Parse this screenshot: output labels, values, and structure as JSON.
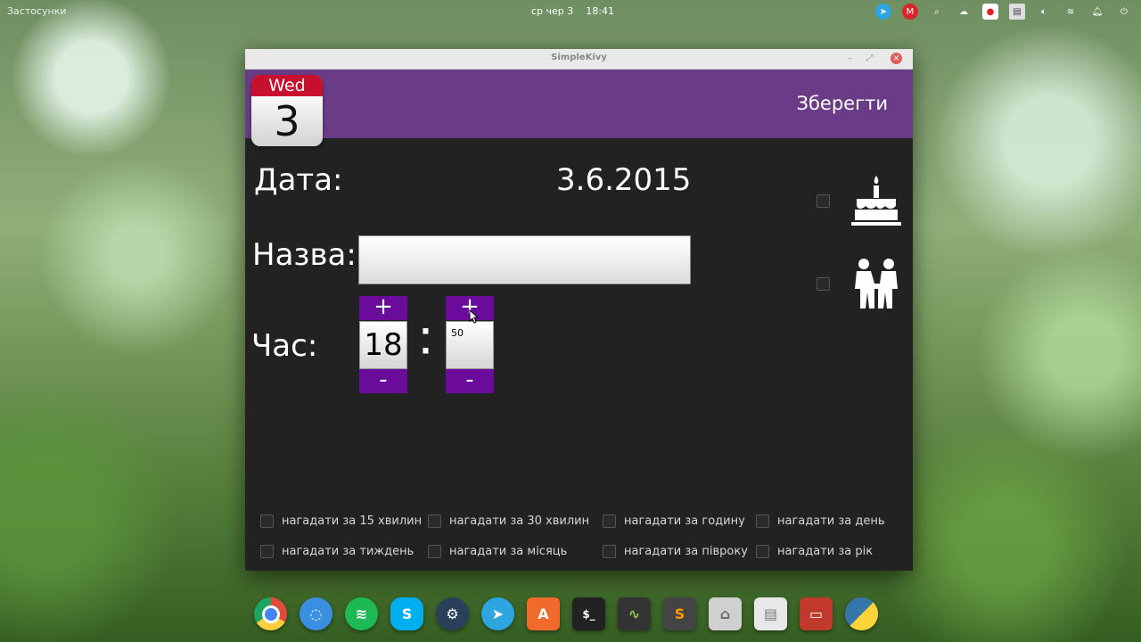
{
  "top_panel": {
    "apps_label": "Застосунки",
    "date": "ср чер 3",
    "time": "18:41",
    "tray_icons": [
      "telegram-icon",
      "mail-m-icon",
      "search-icon",
      "cloud-icon",
      "record-icon",
      "keyboard-icon",
      "volume-icon",
      "wifi-icon",
      "notification-icon",
      "power-icon"
    ]
  },
  "window": {
    "title": "SimpleKivy",
    "header": {
      "calendar_day": "Wed",
      "calendar_number": "3",
      "save_label": "Зберегти",
      "accent_color": "#6a3b87"
    },
    "date_label": "Дата:",
    "date_value": "3.6.2015",
    "name_label": "Назва:",
    "name_value": "",
    "time_label": "Час:",
    "hour": {
      "value": "18",
      "plus": "+",
      "minus": "-"
    },
    "minute": {
      "value": "50",
      "plus": "+",
      "minus": "-"
    },
    "time_separator": ":",
    "event_types": [
      {
        "icon": "birthday-cake-icon",
        "checked": false
      },
      {
        "icon": "meeting-people-icon",
        "checked": false
      }
    ],
    "reminders": [
      {
        "label": "нагадати за 15 хвилин",
        "checked": false
      },
      {
        "label": "нагадати за 30 хвилин",
        "checked": false
      },
      {
        "label": "нагадати за годину",
        "checked": false
      },
      {
        "label": "нагадати за день",
        "checked": false
      },
      {
        "label": "нагадати за тиждень",
        "checked": false
      },
      {
        "label": "нагадати за місяць",
        "checked": false
      },
      {
        "label": "нагадати за півроку",
        "checked": false
      },
      {
        "label": "нагадати за рік",
        "checked": false
      }
    ],
    "spin_color": "#6a0b9c"
  },
  "dock": {
    "items": [
      {
        "name": "chrome-icon",
        "glyph": "",
        "color": "#dd4b39"
      },
      {
        "name": "browser-icon",
        "glyph": "",
        "color": "#3b8fe0"
      },
      {
        "name": "spotify-icon",
        "glyph": "",
        "color": "#1db954"
      },
      {
        "name": "skype-icon",
        "glyph": "S",
        "color": "#00aff0"
      },
      {
        "name": "steam-icon",
        "glyph": "",
        "color": "#2a3f5a"
      },
      {
        "name": "telegram-icon",
        "glyph": "",
        "color": "#2ca5e0"
      },
      {
        "name": "appcenter-icon",
        "glyph": "A",
        "color": "#f06a2b"
      },
      {
        "name": "terminal-icon",
        "glyph": "$_",
        "color": "#222222"
      },
      {
        "name": "system-monitor-icon",
        "glyph": "",
        "color": "#333333"
      },
      {
        "name": "sublime-icon",
        "glyph": "S",
        "color": "#444444"
      },
      {
        "name": "files-icon",
        "glyph": "",
        "color": "#d0d0d0"
      },
      {
        "name": "keyboard-app-icon",
        "glyph": "",
        "color": "#e8e8e8"
      },
      {
        "name": "screen-recorder-icon",
        "glyph": "",
        "color": "#c0392b"
      },
      {
        "name": "python-icon",
        "glyph": "",
        "color": "#3776ab"
      }
    ]
  }
}
